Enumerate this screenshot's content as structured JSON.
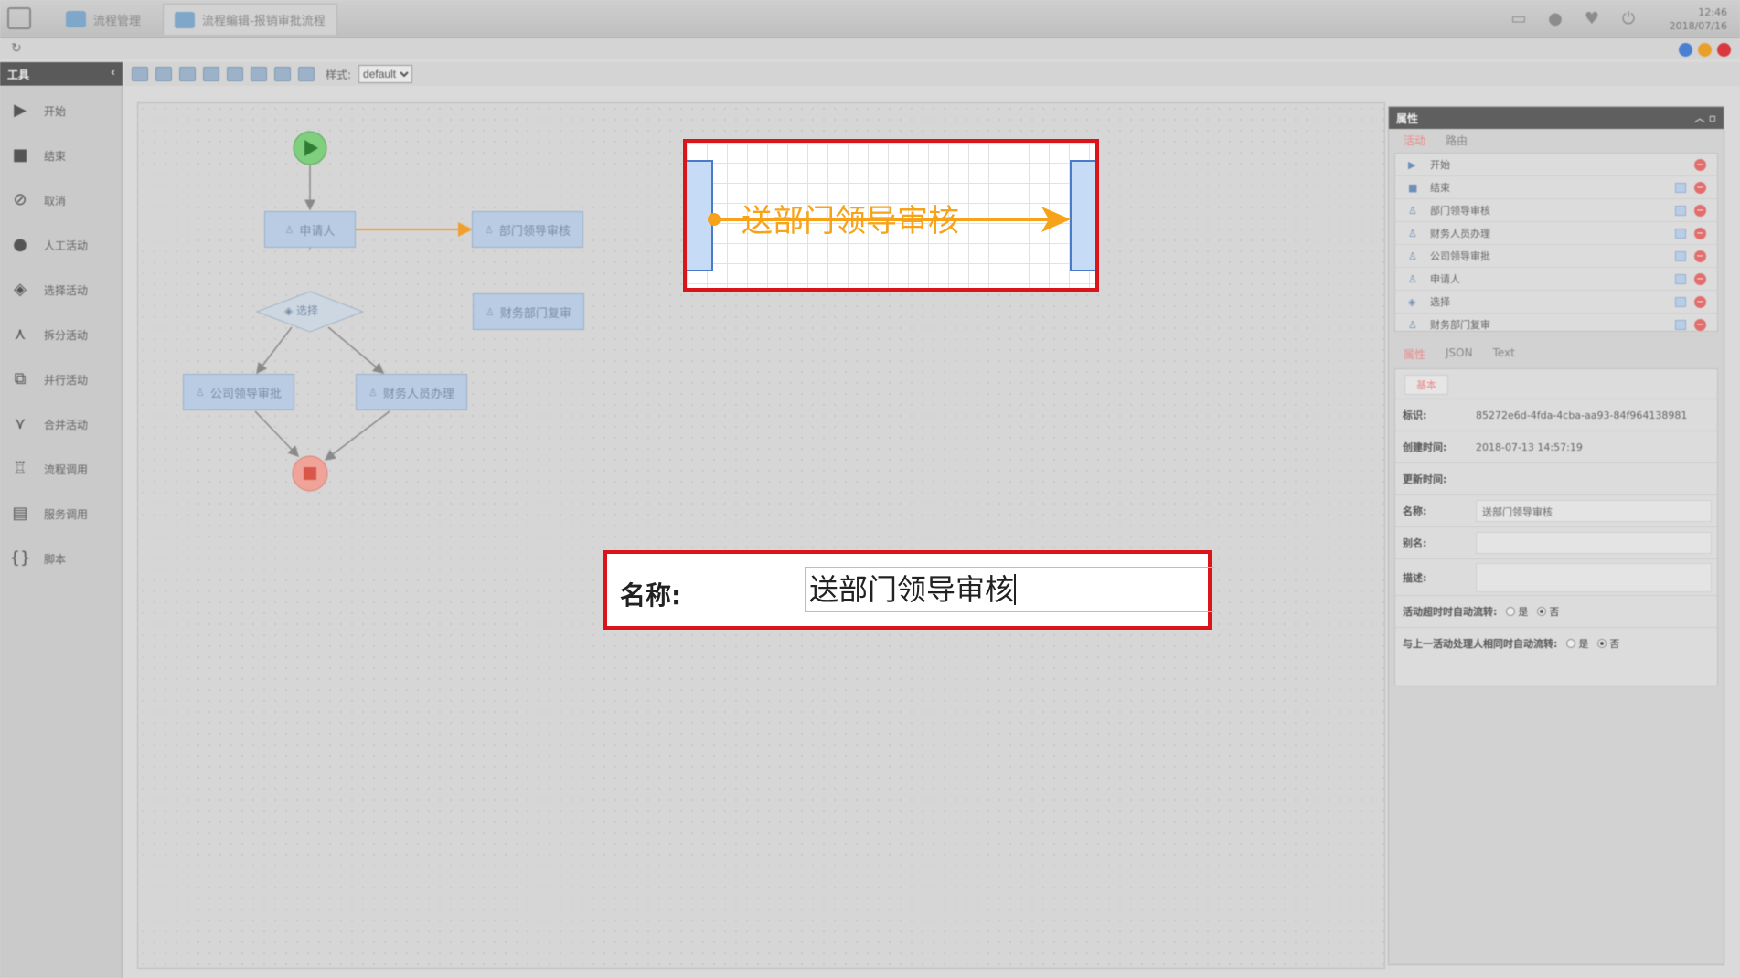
{
  "topbar": {
    "tabs": [
      {
        "label": "流程管理"
      },
      {
        "label": "流程编辑-报销审批流程"
      }
    ],
    "clock": {
      "time": "12:46",
      "date": "2018/07/16"
    },
    "window_dots": [
      "#4a7fd4",
      "#e8a02a",
      "#d9393e"
    ]
  },
  "toolbox": {
    "title": "工具",
    "items": [
      {
        "icon": "play-icon",
        "label": "开始"
      },
      {
        "icon": "stop-icon",
        "label": "结束"
      },
      {
        "icon": "cancel-icon",
        "label": "取消"
      },
      {
        "icon": "person-icon",
        "label": "人工活动"
      },
      {
        "icon": "eye-icon",
        "label": "选择活动"
      },
      {
        "icon": "split-icon",
        "label": "拆分活动"
      },
      {
        "icon": "parallel-icon",
        "label": "并行活动"
      },
      {
        "icon": "merge-icon",
        "label": "合并活动"
      },
      {
        "icon": "hierarchy-icon",
        "label": "流程调用"
      },
      {
        "icon": "service-icon",
        "label": "服务调用"
      },
      {
        "icon": "braces-icon",
        "label": "脚本"
      }
    ]
  },
  "toolbar": {
    "style_label": "样式:",
    "style_value": "default"
  },
  "flow": {
    "nodes": [
      {
        "id": "applicant",
        "label": "申请人"
      },
      {
        "id": "dept",
        "label": "部门领导审核"
      },
      {
        "id": "finance_review",
        "label": "财务部门复审"
      },
      {
        "id": "choice",
        "label": "选择"
      },
      {
        "id": "company",
        "label": "公司领导审批"
      },
      {
        "id": "finance_staff",
        "label": "财务人员办理"
      }
    ]
  },
  "properties": {
    "title": "属性",
    "list_tabs": [
      "活动",
      "路由"
    ],
    "activities": [
      {
        "icon": "play-icon",
        "label": "开始",
        "copy": false
      },
      {
        "icon": "stop-icon",
        "label": "结束",
        "copy": true
      },
      {
        "icon": "person-icon",
        "label": "部门领导审核",
        "copy": true
      },
      {
        "icon": "person-icon",
        "label": "财务人员办理",
        "copy": true
      },
      {
        "icon": "person-icon",
        "label": "公司领导审批",
        "copy": true
      },
      {
        "icon": "person-icon",
        "label": "申请人",
        "copy": true
      },
      {
        "icon": "eye-icon",
        "label": "选择",
        "copy": true
      },
      {
        "icon": "person-icon",
        "label": "财务部门复审",
        "copy": true
      }
    ],
    "form_tabs": [
      "属性",
      "JSON",
      "Text"
    ],
    "group_tab": "基本",
    "fields": {
      "id_label": "标识:",
      "id_value": "85272e6d-4fda-4cba-aa93-84f964138981",
      "created_label": "创建时间:",
      "created_value": "2018-07-13 14:57:19",
      "updated_label": "更新时间:",
      "name_label": "名称:",
      "name_value": "送部门领导审核",
      "alias_label": "别名:",
      "desc_label": "描述:",
      "timeout_label": "活动超时时自动流转:",
      "same_handler_label": "与上一活动处理人相同时自动流转:",
      "yes": "是",
      "no": "否"
    }
  },
  "zoom": {
    "route_label": "送部门领导审核",
    "name_label": "名称:",
    "name_value": "送部门领导审核",
    "highlight_color": "#d9141b",
    "route_color": "#f7a31a"
  }
}
